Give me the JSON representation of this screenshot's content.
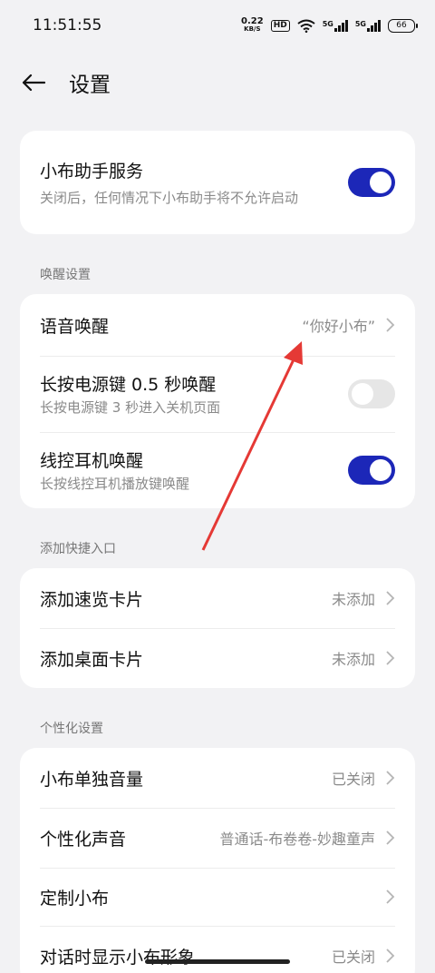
{
  "status": {
    "time": "11:51:55",
    "net_speed": "0.22",
    "net_unit": "KB/S",
    "hd": "HD",
    "sig1": "5G",
    "sig2": "5G",
    "battery": "66"
  },
  "header": {
    "title": "设置"
  },
  "assistant": {
    "label": "小布助手服务",
    "desc": "关闭后，任何情况下小布助手将不允许启动",
    "on": true
  },
  "wake": {
    "section": "唤醒设置",
    "voice_label": "语音唤醒",
    "voice_value": "“你好小布”",
    "power_label": "长按电源键 0.5 秒唤醒",
    "power_desc": "长按电源键 3 秒进入关机页面",
    "power_on": false,
    "earphone_label": "线控耳机唤醒",
    "earphone_desc": "长按线控耳机播放键唤醒",
    "earphone_on": true
  },
  "shortcut": {
    "section": "添加快捷入口",
    "quick_label": "添加速览卡片",
    "quick_value": "未添加",
    "desktop_label": "添加桌面卡片",
    "desktop_value": "未添加"
  },
  "personal": {
    "section": "个性化设置",
    "volume_label": "小布单独音量",
    "volume_value": "已关闭",
    "voice_label": "个性化声音",
    "voice_value": "普通话-布卷卷-妙趣童声",
    "custom_label": "定制小布",
    "avatar_label": "对话时显示小布形象",
    "avatar_value": "已关闭"
  },
  "colors": {
    "accent": "#1c27b8",
    "annotation": "#e53935"
  }
}
